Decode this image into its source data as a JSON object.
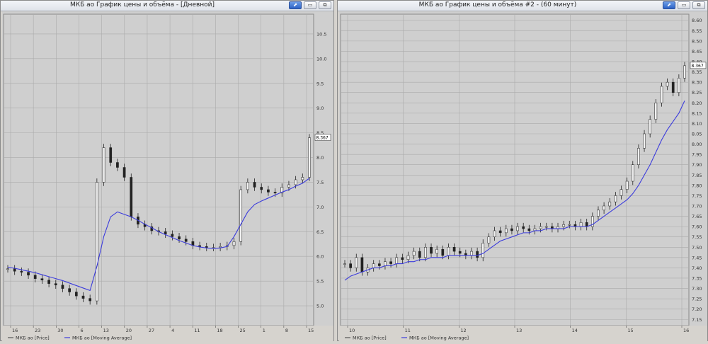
{
  "windows": [
    {
      "title": "МКБ ао График цены и объёма - [Дневной]"
    },
    {
      "title": "МКБ ао График цены и объёма #2 - (60 минут)"
    }
  ],
  "chart_data": [
    {
      "type": "line",
      "title": "МКБ ао График цены и объёма - [Дневной]",
      "y_ticks": [
        "5.0",
        "5.5",
        "6.0",
        "6.5",
        "7.0",
        "7.5",
        "8.0",
        "8.5",
        "9.0",
        "9.5",
        "10.0",
        "10.5"
      ],
      "ylim": [
        4.6,
        10.9
      ],
      "x_ticks": [
        "16",
        "23",
        "30",
        "6",
        "13",
        "20",
        "27",
        "4",
        "11",
        "18",
        "25",
        "1",
        "8",
        "15"
      ],
      "last_price_label": "8.367",
      "legend": [
        {
          "name": "МКБ ао [Price]",
          "color": "#555555"
        },
        {
          "name": "МКБ ао [Moving Average]",
          "color": "#3c3cdc"
        }
      ],
      "grid": true,
      "colors": {
        "price": "#222222",
        "ma": "#3c3cdc",
        "background": "#cfcfcf",
        "grid": "#ababab"
      },
      "series": [
        {
          "name": "МКБ ао [Price]",
          "values": [
            5.75,
            5.7,
            5.68,
            5.62,
            5.55,
            5.52,
            5.45,
            5.42,
            5.35,
            5.28,
            5.2,
            5.15,
            5.1,
            7.5,
            8.2,
            7.9,
            7.8,
            7.6,
            6.8,
            6.65,
            6.6,
            6.52,
            6.5,
            6.45,
            6.4,
            6.35,
            6.3,
            6.22,
            6.2,
            6.18,
            6.18,
            6.2,
            6.22,
            6.3,
            7.35,
            7.5,
            7.4,
            7.35,
            7.3,
            7.28,
            7.4,
            7.45,
            7.55,
            7.6,
            8.4
          ]
        },
        {
          "name": "МКБ ао [Moving Average]",
          "values": [
            5.78,
            5.76,
            5.73,
            5.7,
            5.67,
            5.63,
            5.59,
            5.55,
            5.51,
            5.46,
            5.41,
            5.36,
            5.31,
            5.8,
            6.4,
            6.8,
            6.9,
            6.85,
            6.8,
            6.73,
            6.65,
            6.58,
            6.5,
            6.44,
            6.38,
            6.32,
            6.27,
            6.22,
            6.19,
            6.17,
            6.16,
            6.17,
            6.2,
            6.4,
            6.65,
            6.9,
            7.05,
            7.12,
            7.18,
            7.24,
            7.3,
            7.35,
            7.42,
            7.48,
            7.58
          ]
        }
      ]
    },
    {
      "type": "line",
      "title": "МКБ ао График цены и объёма #2 - (60 минут)",
      "y_ticks": [
        "7.15",
        "7.20",
        "7.25",
        "7.30",
        "7.35",
        "7.40",
        "7.45",
        "7.50",
        "7.55",
        "7.60",
        "7.65",
        "7.70",
        "7.75",
        "7.80",
        "7.85",
        "7.90",
        "7.95",
        "8.00",
        "8.05",
        "8.10",
        "8.15",
        "8.20",
        "8.25",
        "8.30",
        "8.35",
        "8.40",
        "8.45",
        "8.50",
        "8.55",
        "8.60"
      ],
      "ylim": [
        7.12,
        8.63
      ],
      "x_ticks": [
        "10",
        "11",
        "12",
        "13",
        "14",
        "15",
        "16"
      ],
      "last_price_label": "8.367",
      "legend": [
        {
          "name": "МКБ ао [Price]",
          "color": "#555555"
        },
        {
          "name": "МКБ ао [Moving Average]",
          "color": "#3c3cdc"
        }
      ],
      "grid": true,
      "colors": {
        "price": "#222222",
        "ma": "#3c3cdc",
        "background": "#cfcfcf",
        "grid": "#ababab"
      },
      "series": [
        {
          "name": "МКБ ао [Price]",
          "values": [
            7.42,
            7.4,
            7.45,
            7.38,
            7.4,
            7.42,
            7.41,
            7.43,
            7.42,
            7.45,
            7.44,
            7.46,
            7.48,
            7.45,
            7.5,
            7.47,
            7.49,
            7.46,
            7.5,
            7.48,
            7.47,
            7.46,
            7.48,
            7.45,
            7.52,
            7.55,
            7.58,
            7.57,
            7.59,
            7.58,
            7.6,
            7.59,
            7.58,
            7.59,
            7.6,
            7.6,
            7.59,
            7.6,
            7.61,
            7.61,
            7.6,
            7.62,
            7.6,
            7.65,
            7.68,
            7.7,
            7.72,
            7.75,
            7.78,
            7.82,
            7.9,
            7.98,
            8.05,
            8.12,
            8.2,
            8.28,
            8.3,
            8.25,
            8.32,
            8.38
          ]
        },
        {
          "name": "МКБ ао [Moving Average]",
          "values": [
            7.34,
            7.36,
            7.37,
            7.38,
            7.39,
            7.4,
            7.4,
            7.41,
            7.41,
            7.42,
            7.42,
            7.43,
            7.43,
            7.44,
            7.44,
            7.45,
            7.45,
            7.45,
            7.46,
            7.46,
            7.46,
            7.46,
            7.46,
            7.46,
            7.47,
            7.49,
            7.51,
            7.53,
            7.54,
            7.55,
            7.56,
            7.57,
            7.57,
            7.58,
            7.58,
            7.59,
            7.59,
            7.59,
            7.59,
            7.6,
            7.6,
            7.6,
            7.6,
            7.61,
            7.63,
            7.65,
            7.67,
            7.69,
            7.71,
            7.73,
            7.76,
            7.8,
            7.85,
            7.9,
            7.96,
            8.02,
            8.07,
            8.11,
            8.15,
            8.21
          ]
        }
      ]
    }
  ]
}
